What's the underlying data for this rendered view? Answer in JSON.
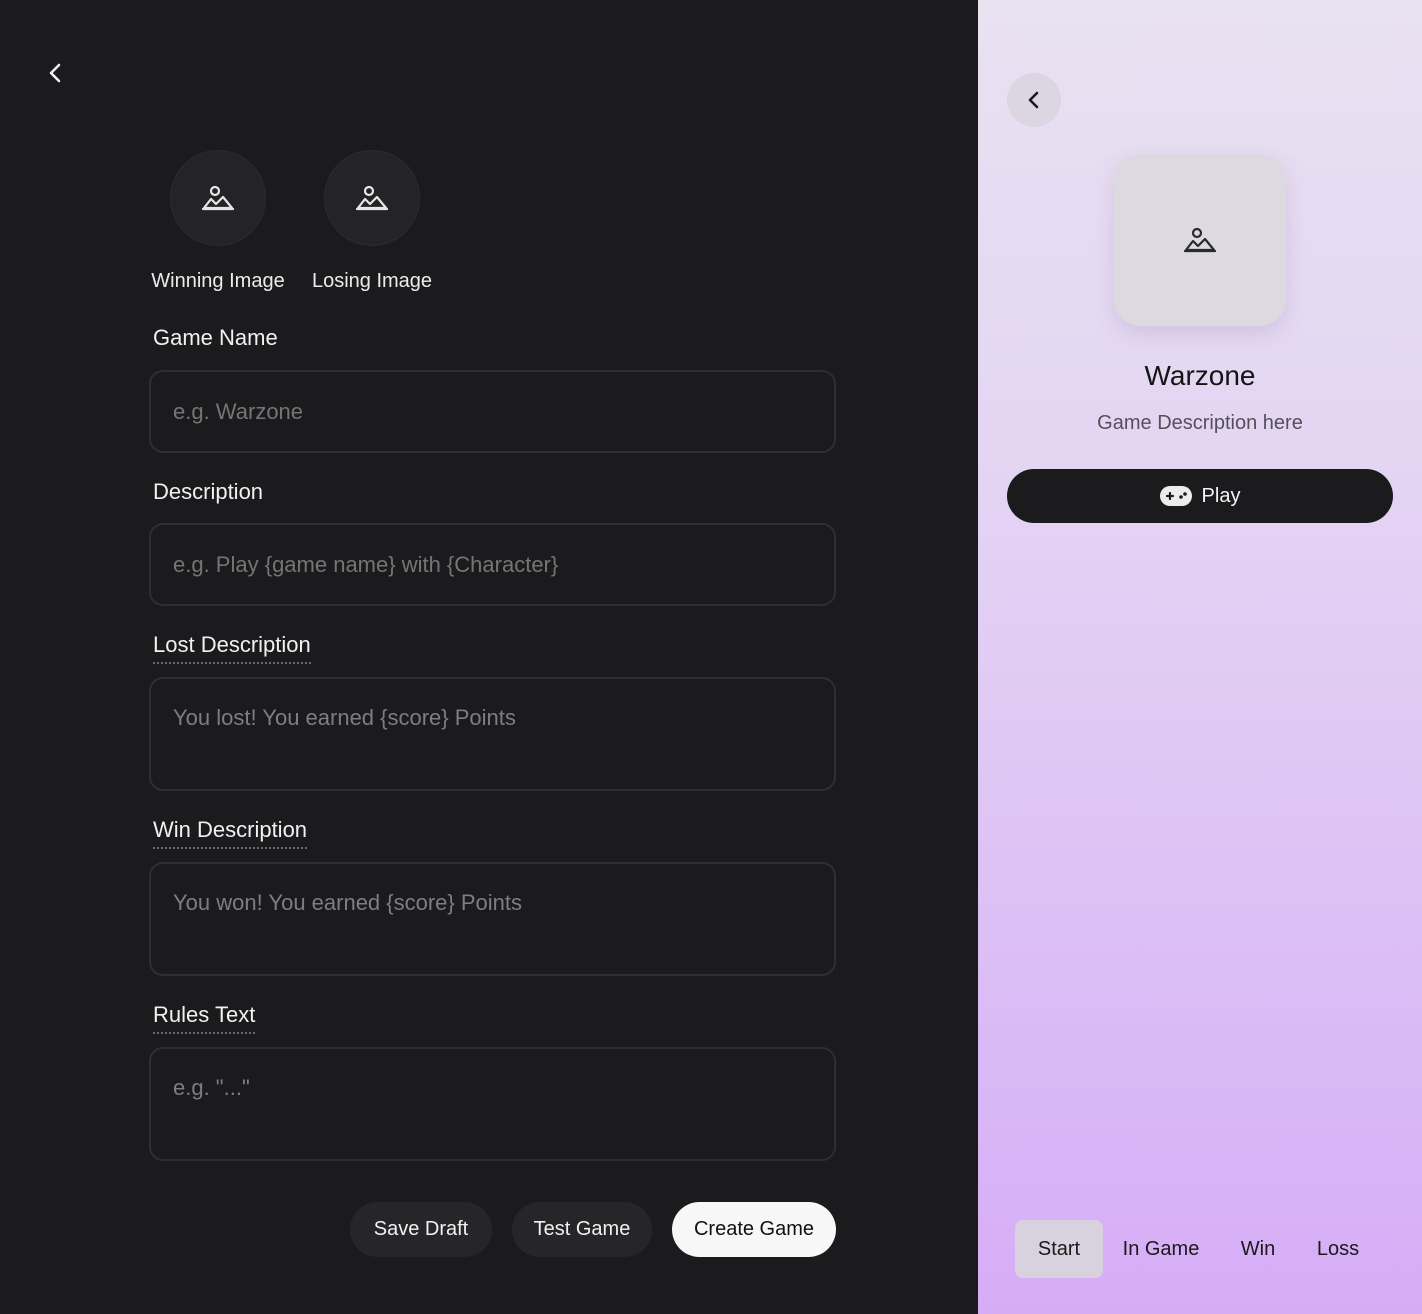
{
  "editor": {
    "images": [
      {
        "label": "Winning Image",
        "icon": "image-icon"
      },
      {
        "label": "Losing Image",
        "icon": "image-icon"
      }
    ],
    "fields": {
      "game_name": {
        "label": "Game Name",
        "placeholder": "e.g. Warzone"
      },
      "description": {
        "label": "Description",
        "placeholder": "e.g. Play {game name} with {Character}"
      },
      "lost_description": {
        "label": "Lost Description",
        "placeholder": "You lost! You earned {score} Points"
      },
      "win_description": {
        "label": "Win Description",
        "placeholder": "You won! You earned {score} Points"
      },
      "rules_text": {
        "label": "Rules Text",
        "placeholder": "e.g. \"...\""
      }
    },
    "buttons": {
      "save_draft": "Save Draft",
      "test_game": "Test Game",
      "create_game": "Create Game"
    }
  },
  "preview": {
    "title": "Warzone",
    "description": "Game Description here",
    "play_label": "Play",
    "tabs": [
      "Start",
      "In Game",
      "Win",
      "Loss"
    ],
    "active_tab": "Start"
  },
  "colors": {
    "editor_bg": "#1b1b1d",
    "preview_gradient_top": "#e9e2f1",
    "preview_gradient_bottom": "#d6acf7"
  }
}
